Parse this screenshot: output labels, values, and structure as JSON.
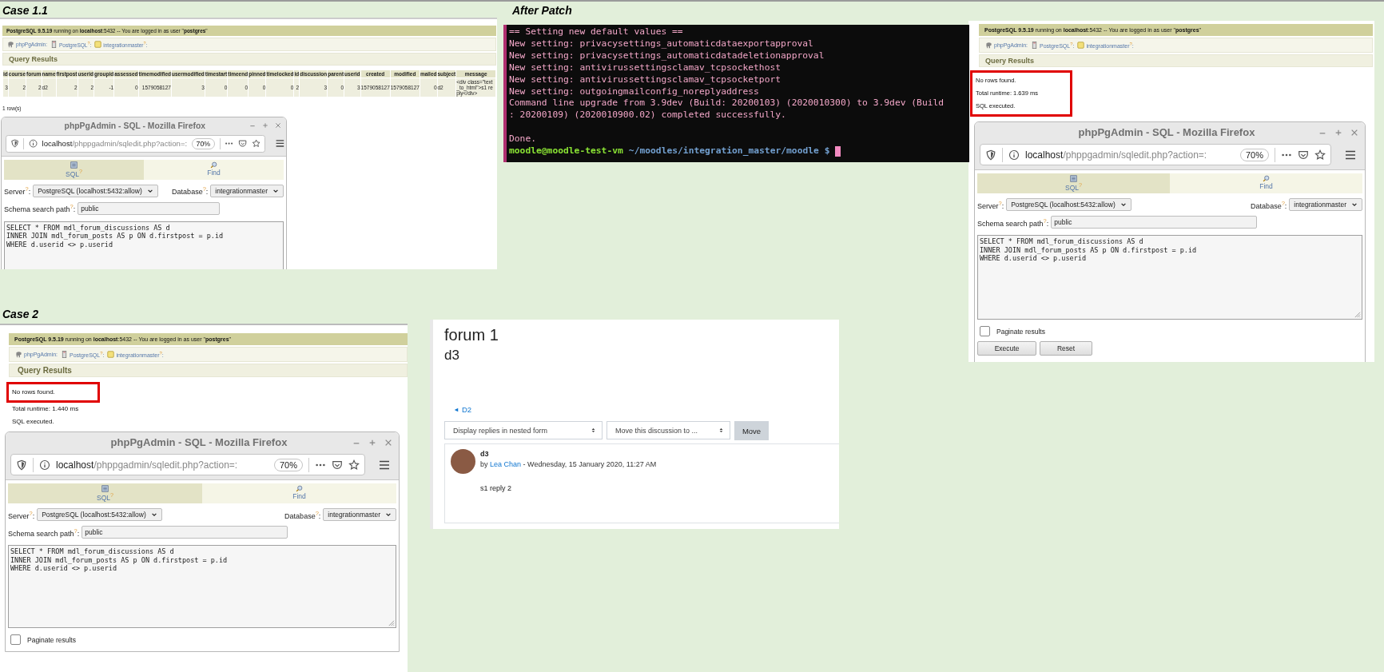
{
  "case_1_1": {
    "caption": "Case 1.1",
    "page": {
      "pg_header": "**PostgreSQL 9.5.19** running on **localhost**:5432 -- You are logged in as user \"**postgres**\"",
      "breadcrumb": [
        {
          "kind": "root",
          "text": "phpPgAdmin:"
        },
        {
          "kind": "server",
          "text": "PostgreSQL$^{?}$:"
        },
        {
          "kind": "database",
          "text": "integrationmaster$^{?}$:"
        }
      ],
      "section_title": "Query Results",
      "results_table": {
        "columns": [
          "id",
          "course",
          "forum",
          "name",
          "firstpost",
          "userid",
          "groupid",
          "assessed",
          "timemodified",
          "usermodified",
          "timestart",
          "timeend",
          "pinned",
          "timelocked",
          "id",
          "discussion",
          "parent",
          "userid",
          "created",
          "modified",
          "mailed",
          "subject",
          "message"
        ],
        "rows": [
          [
            "3",
            "2",
            "2",
            "d2",
            "2",
            "2",
            "-1",
            "0",
            "1579058127",
            "3",
            "0",
            "0",
            "0",
            "0",
            "2",
            "3",
            "0",
            "3",
            "1579058127",
            "1579058127",
            "0",
            "d2",
            "<div class=\"text_to_html\">s1 reply</div>"
          ]
        ]
      },
      "row_count": "1 row(s)",
      "browser": {
        "title": "phpPgAdmin - SQL - Mozilla Firefox",
        "url_host": "localhost",
        "url_path": "/phppgadmin/sqledit.php?action=:",
        "zoom": "70%",
        "tabs": [
          {
            "kind": "sql",
            "label": "SQL$^{?}$",
            "selected": true
          },
          {
            "kind": "find",
            "label": "Find",
            "selected": false
          }
        ],
        "server_label": "Server$^{?}$:",
        "server_value": "PostgreSQL (localhost:5432:allow)",
        "database_label": "Database$^{?}$:",
        "database_value": "integrationmaster",
        "schema_label": "Schema search path$^{?}$:",
        "schema_value": "public",
        "sql_lines": [
          "SELECT * FROM mdl_forum_discussions AS d",
          "INNER JOIN mdl_forum_posts AS p ON d.firstpost = p.id",
          "WHERE d.userid <> p.userid"
        ]
      }
    }
  },
  "after_patch": {
    "caption": "After Patch",
    "terminal": [
      {
        "kind": "output",
        "text": "== Setting new default values =="
      },
      {
        "kind": "output",
        "text": "New setting: privacysettings_automaticdataexportapproval"
      },
      {
        "kind": "output",
        "text": "New setting: privacysettings_automaticdatadeletionapproval"
      },
      {
        "kind": "output",
        "text": "New setting: antivirussettingsclamav_tcpsockethost"
      },
      {
        "kind": "output",
        "text": "New setting: antivirussettingsclamav_tcpsocketport"
      },
      {
        "kind": "output",
        "text": "New setting: outgoingmailconfig_noreplyaddress"
      },
      {
        "kind": "output",
        "text": "Command line upgrade from 3.9dev (Build: 20200103) (2020010300) to 3.9dev (Build"
      },
      {
        "kind": "output",
        "text": ": 20200109) (2020010900.02) completed successfully."
      },
      {
        "kind": "gap"
      },
      {
        "kind": "output",
        "text": "Done."
      },
      {
        "kind": "prompt",
        "user_host": "moodle@moodle-test-vm",
        "path": "~/moodles/integration_master/moodle $"
      }
    ]
  },
  "top_right": {
    "page": {
      "pg_header": "**PostgreSQL 9.5.19** running on **localhost**:5432 -- You are logged in as user \"**postgres**\"",
      "breadcrumb": [
        {
          "kind": "root",
          "text": "phpPgAdmin:"
        },
        {
          "kind": "server",
          "text": "PostgreSQL$^{?}$:"
        },
        {
          "kind": "database",
          "text": "integrationmaster$^{?}$:"
        }
      ],
      "section_title": "Query Results",
      "messages": [
        {
          "text": "No rows found.",
          "highlighted": true
        },
        {
          "text": "Total runtime: 1.639 ms",
          "highlighted": true
        },
        {
          "text": "SQL executed.",
          "highlighted": true
        }
      ],
      "browser": {
        "title": "phpPgAdmin - SQL - Mozilla Firefox",
        "url_host": "localhost",
        "url_path": "/phppgadmin/sqledit.php?action=:",
        "zoom": "70%",
        "tabs": [
          {
            "kind": "sql",
            "label": "SQL$^{?}$",
            "selected": true
          },
          {
            "kind": "find",
            "label": "Find",
            "selected": false
          }
        ],
        "server_label": "Server$^{?}$:",
        "server_value": "PostgreSQL (localhost:5432:allow)",
        "database_label": "Database$^{?}$:",
        "database_value": "integrationmaster",
        "schema_label": "Schema search path$^{?}$:",
        "schema_value": "public",
        "sql_lines": [
          "SELECT * FROM mdl_forum_discussions AS d",
          "INNER JOIN mdl_forum_posts AS p ON d.firstpost = p.id",
          "WHERE d.userid <> p.userid"
        ],
        "paginate": {
          "label": "Paginate results",
          "checked": false
        },
        "buttons": [
          "Execute",
          "Reset"
        ]
      }
    }
  },
  "case_2": {
    "caption": "Case 2",
    "page": {
      "pg_header": "**PostgreSQL 9.5.19** running on **localhost**:5432 -- You are logged in as user \"**postgres**\"",
      "breadcrumb": [
        {
          "kind": "root",
          "text": "phpPgAdmin:"
        },
        {
          "kind": "server",
          "text": "PostgreSQL$^{?}$:"
        },
        {
          "kind": "database",
          "text": "integrationmaster$^{?}$:"
        }
      ],
      "section_title": "Query Results",
      "messages": [
        {
          "text": "No rows found.",
          "highlighted": true
        },
        {
          "text": "Total runtime: 1.440 ms",
          "highlighted": false
        },
        {
          "text": "SQL executed.",
          "highlighted": false
        }
      ],
      "browser": {
        "title": "phpPgAdmin - SQL - Mozilla Firefox",
        "url_host": "localhost",
        "url_path": "/phppgadmin/sqledit.php?action=:",
        "zoom": "70%",
        "tabs": [
          {
            "kind": "sql",
            "label": "SQL$^{?}$",
            "selected": true
          },
          {
            "kind": "find",
            "label": "Find",
            "selected": false
          }
        ],
        "server_label": "Server$^{?}$:",
        "server_value": "PostgreSQL (localhost:5432:allow)",
        "database_label": "Database$^{?}$:",
        "database_value": "integrationmaster",
        "schema_label": "Schema search path$^{?}$:",
        "schema_value": "public",
        "sql_lines": [
          "SELECT * FROM mdl_forum_discussions AS d",
          "INNER JOIN mdl_forum_posts AS p ON d.firstpost = p.id",
          "WHERE d.userid <> p.userid"
        ],
        "paginate": {
          "label": "Paginate results",
          "checked": false
        }
      }
    }
  },
  "forum_page": {
    "forum_title": "forum 1",
    "discussion_title": "d3",
    "previous_link": "D2",
    "display_select": "Display replies in nested form",
    "move_select": "Move this discussion to ...",
    "move_button": "Move",
    "post": {
      "subject": "d3",
      "by": "by",
      "author": "Lea Chan",
      "date": "- Wednesday, 15 January 2020, 11:27 AM",
      "body": "s1 reply 2"
    }
  }
}
